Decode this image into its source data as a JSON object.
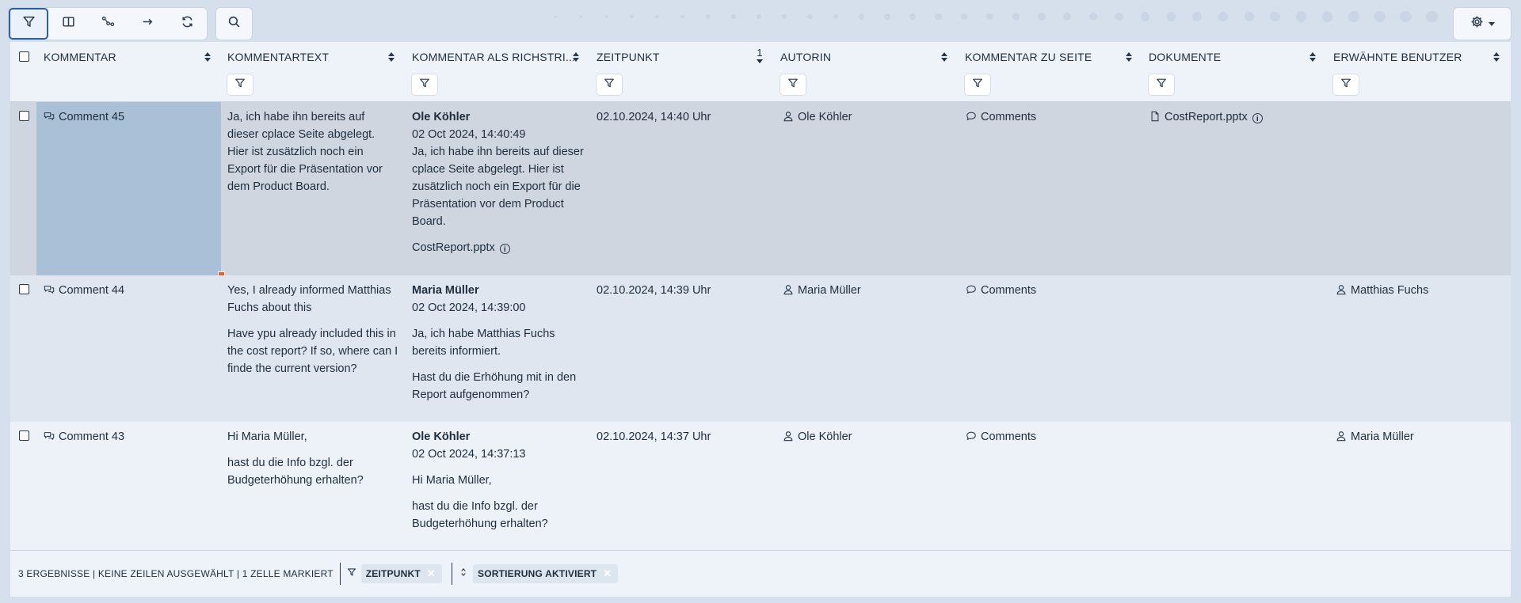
{
  "toolbar": {
    "buttons": [
      "filter-icon",
      "columns-icon",
      "relations-icon",
      "arrow-right-icon",
      "refresh-icon"
    ],
    "search": "search-icon",
    "settings": "gear-icon"
  },
  "table": {
    "columns": [
      {
        "label": "KOMMENTAR",
        "sort": "sortable"
      },
      {
        "label": "KOMMENTARTEXT",
        "sort": "sortable"
      },
      {
        "label": "KOMMENTAR ALS RICHSTRI...",
        "sort": "sortable"
      },
      {
        "label": "ZEITPUNKT",
        "sort": "descending",
        "sort_index": "1"
      },
      {
        "label": "AUTORIN",
        "sort": "sortable"
      },
      {
        "label": "KOMMENTAR ZU SEITE",
        "sort": "sortable"
      },
      {
        "label": "DOKUMENTE",
        "sort": "sortable"
      },
      {
        "label": "ERWÄHNTE BENUTZER",
        "sort": "sortable"
      }
    ],
    "rows": [
      {
        "name": "Comment 45",
        "text": [
          "Ja, ich habe ihn bereits auf dieser cplace Seite abgelegt. Hier ist zusätzlich noch ein Export für die Präsentation vor dem Product Board."
        ],
        "rich_author": "Ole Köhler",
        "rich_date": "02 Oct 2024, 14:40:49",
        "rich_paras": [
          "Ja, ich habe ihn bereits auf dieser cplace Seite abgelegt. Hier ist zusätzlich noch ein Export für die Präsentation vor dem Product Board."
        ],
        "rich_attachment": "CostReport.pptx",
        "time": "02.10.2024, 14:40 Uhr",
        "author": "Ole Köhler",
        "page": "Comments",
        "document": "CostReport.pptx",
        "mentioned": ""
      },
      {
        "name": "Comment 44",
        "text": [
          "Yes, I already informed Matthias Fuchs about this",
          "Have ypu already included this in the cost report? If so, where can I finde the current version?"
        ],
        "rich_author": "Maria Müller",
        "rich_date": "02 Oct 2024, 14:39:00",
        "rich_paras": [
          "Ja, ich habe Matthias Fuchs bereits informiert.",
          "Hast du die Erhöhung mit in den Report aufgenommen?"
        ],
        "rich_attachment": "",
        "time": "02.10.2024, 14:39 Uhr",
        "author": "Maria Müller",
        "page": "Comments",
        "document": "",
        "mentioned": "Matthias Fuchs"
      },
      {
        "name": "Comment 43",
        "text": [
          "Hi Maria Müller,",
          "hast du die Info bzgl. der Budgeterhöhung erhalten?"
        ],
        "rich_author": "Ole Köhler",
        "rich_date": "02 Oct 2024, 14:37:13",
        "rich_paras": [
          "Hi Maria Müller,",
          "hast du die Info bzgl. der Budgeterhöhung erhalten?"
        ],
        "rich_attachment": "",
        "time": "02.10.2024, 14:37 Uhr",
        "author": "Ole Köhler",
        "page": "Comments",
        "document": "",
        "mentioned": "Maria Müller"
      }
    ]
  },
  "footer": {
    "summary": "3 ERGEBNISSE | KEINE ZEILEN AUSGEWÄHLT | 1 ZELLE MARKIERT",
    "filter_chip": "ZEITPUNKT",
    "sort_chip": "SORTIERUNG AKTIVIERT"
  },
  "colors": {
    "selected_cell": "#a9c0d7",
    "toolbar_active_border": "#2c5fa3",
    "selection_handle": "#e0622a"
  }
}
